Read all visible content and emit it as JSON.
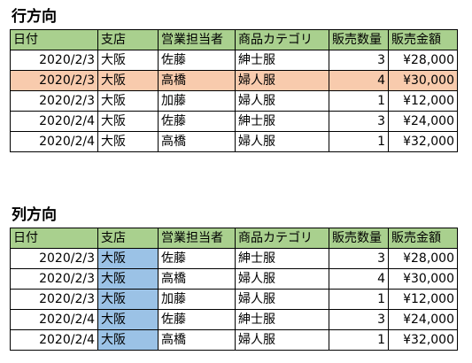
{
  "row_section": {
    "title": "行方向",
    "headers": [
      "日付",
      "支店",
      "営業担当者",
      "商品カテゴリ",
      "販売数量",
      "販売金額"
    ],
    "rows": [
      [
        "2020/2/3",
        "大阪",
        "佐藤",
        "紳士服",
        "3",
        "¥28,000"
      ],
      [
        "2020/2/3",
        "大阪",
        "高橋",
        "婦人服",
        "4",
        "¥30,000"
      ],
      [
        "2020/2/3",
        "大阪",
        "加藤",
        "婦人服",
        "1",
        "¥12,000"
      ],
      [
        "2020/2/4",
        "大阪",
        "佐藤",
        "紳士服",
        "3",
        "¥24,000"
      ],
      [
        "2020/2/4",
        "大阪",
        "高橋",
        "婦人服",
        "1",
        "¥32,000"
      ]
    ],
    "highlighted_row_index": 1
  },
  "column_section": {
    "title": "列方向",
    "headers": [
      "日付",
      "支店",
      "営業担当者",
      "商品カテゴリ",
      "販売数量",
      "販売金額"
    ],
    "rows": [
      [
        "2020/2/3",
        "大阪",
        "佐藤",
        "紳士服",
        "3",
        "¥28,000"
      ],
      [
        "2020/2/3",
        "大阪",
        "高橋",
        "婦人服",
        "4",
        "¥30,000"
      ],
      [
        "2020/2/3",
        "大阪",
        "加藤",
        "婦人服",
        "1",
        "¥12,000"
      ],
      [
        "2020/2/4",
        "大阪",
        "佐藤",
        "紳士服",
        "3",
        "¥24,000"
      ],
      [
        "2020/2/4",
        "大阪",
        "高橋",
        "婦人服",
        "1",
        "¥32,000"
      ]
    ],
    "highlighted_column_index": 1
  },
  "colors": {
    "header_fill": "#a9d08e",
    "row_highlight": "#f8cbad",
    "column_highlight": "#9bc2e6"
  }
}
